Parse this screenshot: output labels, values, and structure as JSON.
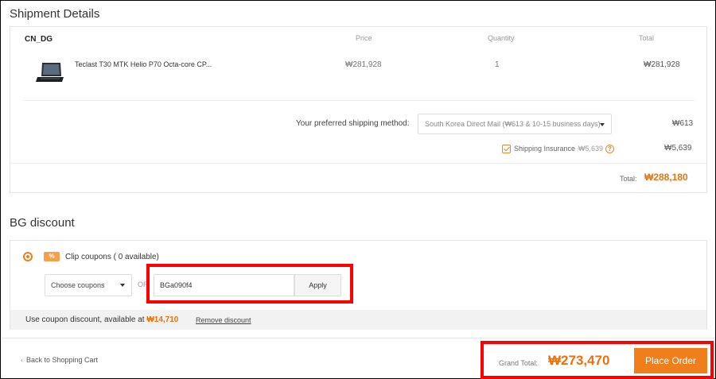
{
  "shipment": {
    "title": "Shipment Details",
    "warehouse": "CN_DG",
    "columns": {
      "price": "Price",
      "quantity": "Quantity",
      "total": "Total"
    },
    "item": {
      "name": "Teclast T30 MTK Helio P70 Octa-core CP...",
      "price": "₩281,928",
      "quantity": "1",
      "total": "₩281,928"
    },
    "shipping_label": "Your preferred shipping method:",
    "shipping_method": "South Korea Direct Mail (₩613 & 10-15 business days)",
    "shipping_cost": "₩613",
    "insurance_label": "Shipping Insurance",
    "insurance_price": "₩5,639",
    "insurance_total": "₩5,639",
    "help_glyph": "?",
    "total_label": "Total:",
    "total_value": "₩288,180"
  },
  "discount": {
    "title": "BG discount",
    "badge": "%",
    "clip_label": "Clip coupons ( 0 available)",
    "choose_label": "Choose coupons",
    "or_label": "OR",
    "coupon_code": "BGa090f4",
    "apply_label": "Apply",
    "use_text": "Use coupon discount, available at",
    "available_amount": "₩14,710",
    "remove_label": "Remove discount"
  },
  "footer": {
    "back_label": "Back to Shopping Cart",
    "grand_total_label": "Grand Total:",
    "grand_total_value": "₩273,470",
    "place_order_label": "Place Order"
  },
  "colors": {
    "accent": "#f07f1b",
    "highlight": "#ff0000"
  }
}
